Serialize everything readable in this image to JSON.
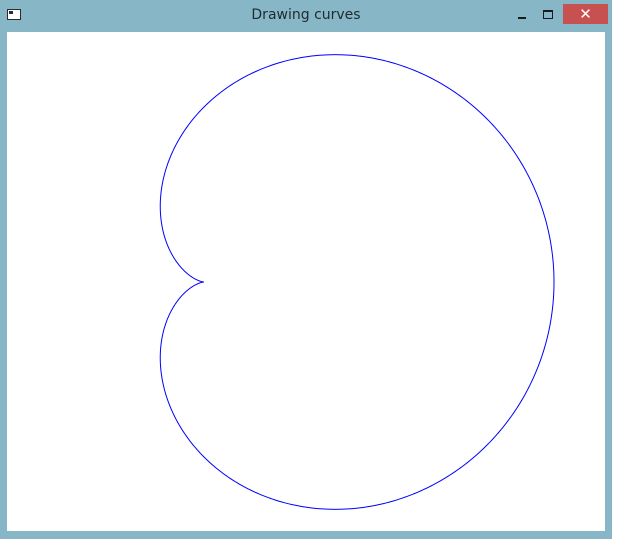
{
  "window": {
    "title": "Drawing curves",
    "controls": {
      "minimize": "minimize",
      "maximize": "maximize",
      "close": "✕"
    }
  },
  "canvas": {
    "background": "#ffffff",
    "curve": {
      "shape": "cardioid",
      "stroke_color": "#0000ff"
    }
  },
  "colors": {
    "window_frame": "#87b7c7",
    "close_button": "#c75050"
  }
}
